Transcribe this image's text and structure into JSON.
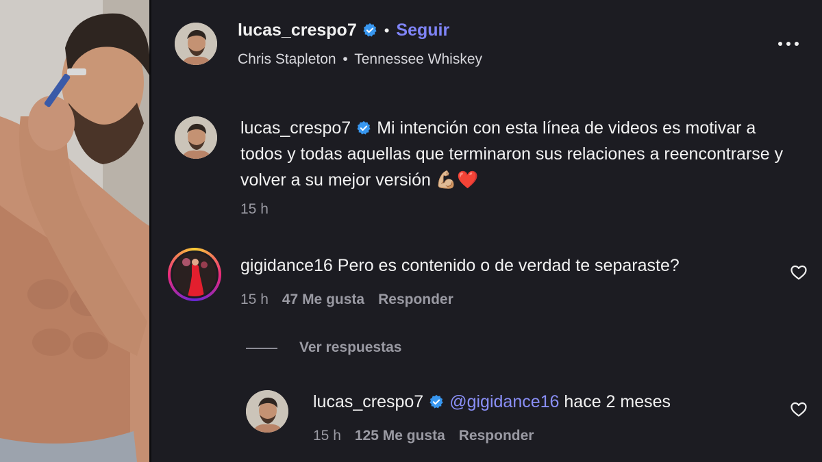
{
  "header": {
    "username": "lucas_crespo7",
    "separator": "•",
    "follow_label": "Seguir",
    "song_artist": "Chris Stapleton",
    "song_separator": "•",
    "song_title": "Tennessee Whiskey",
    "more_icon": "more-options-icon"
  },
  "caption": {
    "username": "lucas_crespo7",
    "text": "Mi intención con esta línea de videos es motivar a todos y todas aquellas que terminaron sus relaciones a reencontrarse y volver a su mejor versión",
    "emojis": "💪🏼❤️",
    "time": "15 h"
  },
  "comments": [
    {
      "username": "gigidance16",
      "text": "Pero es contenido o de verdad te separaste?",
      "time": "15 h",
      "likes": "47 Me gusta",
      "reply_label": "Responder"
    }
  ],
  "view_replies_label": "Ver respuestas",
  "reply": {
    "username": "lucas_crespo7",
    "mention": "@gigidance16",
    "text": "hace 2 meses",
    "time": "15 h",
    "likes": "125 Me gusta",
    "reply_label": "Responder"
  },
  "colors": {
    "background": "#1c1c22",
    "link": "#7f84f7",
    "verified": "#3897f0",
    "meta": "#9a9aa3"
  }
}
